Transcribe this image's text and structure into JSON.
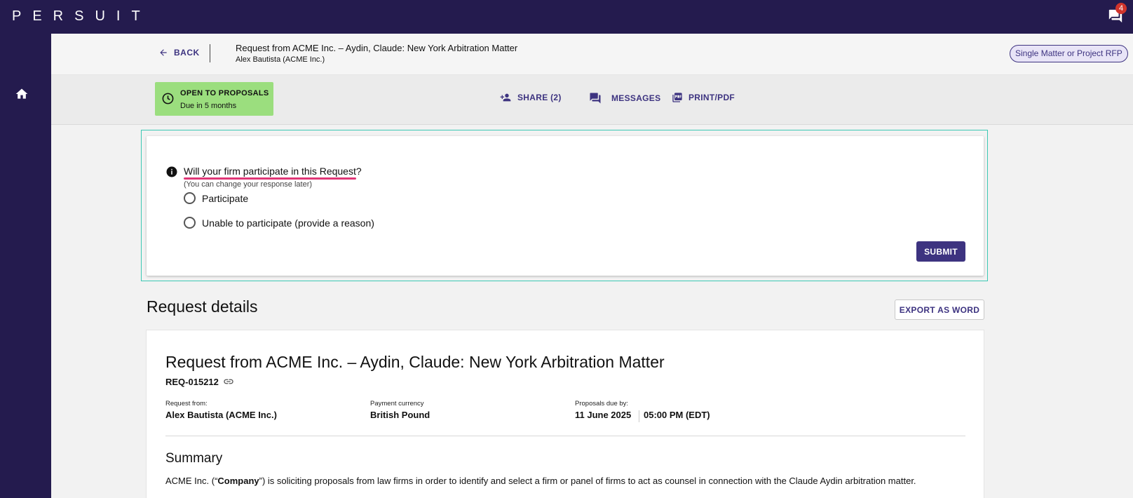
{
  "app": {
    "logo": "PERSUIT",
    "message_count": "4"
  },
  "header": {
    "back_label": "BACK",
    "title": "Request from ACME Inc. – Aydin, Claude: New York Arbitration Matter",
    "subtitle": "Alex Bautista (ACME Inc.)",
    "rfp_type": "Single Matter or Project RFP"
  },
  "status": {
    "title": "OPEN TO PROPOSALS",
    "due": "Due in 5 months",
    "color": "#9bde7e"
  },
  "actions": {
    "share": "SHARE (2)",
    "messages": "MESSAGES",
    "print": "PRINT/PDF"
  },
  "participation": {
    "question": "Will your firm participate in this Request?",
    "note": "(You can change your response later)",
    "option_participate": "Participate",
    "option_decline": "Unable to participate (provide a reason)",
    "submit": "SUBMIT"
  },
  "details": {
    "heading": "Request details",
    "export": "EXPORT AS WORD",
    "title": "Request from ACME Inc. – Aydin, Claude: New York Arbitration Matter",
    "req_id": "REQ-015212",
    "request_from_label": "Request from:",
    "request_from_value": "Alex Bautista (ACME Inc.)",
    "currency_label": "Payment currency",
    "currency_value": "British Pound",
    "due_label": "Proposals due by:",
    "due_date": "11 June 2025",
    "due_time": "05:00 PM (EDT)",
    "summary_heading": "Summary",
    "summary_pre": "ACME Inc. (“",
    "summary_bold": "Company",
    "summary_post": "”) is soliciting proposals from law firms in order to identify and select a firm or panel of firms to act as counsel in connection with the Claude Aydin arbitration matter."
  },
  "colors": {
    "nav": "#241b4e",
    "accent": "#3d3380",
    "highlight_border": "#3cc8b4",
    "underline": "#e03777",
    "badge": "#d0342c"
  }
}
